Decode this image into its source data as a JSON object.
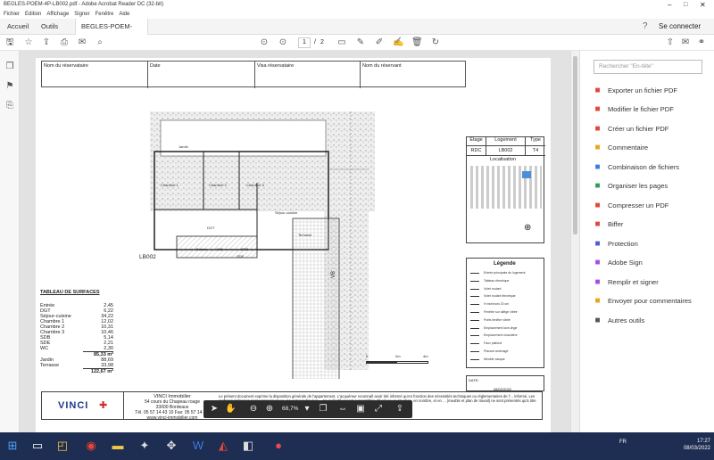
{
  "window": {
    "title": "BEGLES-POEM-4P-LB002.pdf - Adobe Acrobat Reader DC (32-bit)"
  },
  "menu": [
    "Fichier",
    "Edition",
    "Affichage",
    "Signer",
    "Fenêtre",
    "Aide"
  ],
  "tabs": {
    "home": "Accueil",
    "tools": "Outils",
    "doc": "BEGLES-POEM-4P-..."
  },
  "signin": "Se connecter",
  "pager": {
    "current": "1",
    "sep": "/",
    "total": "2"
  },
  "zoom": "68,7%",
  "panel": {
    "search_placeholder": "Rechercher \"En-tête\"",
    "items": [
      {
        "label": "Exporter un fichier PDF",
        "color": "#e3463b",
        "icon": "export-pdf-icon"
      },
      {
        "label": "Modifier le fichier PDF",
        "color": "#e3463b",
        "icon": "edit-pdf-icon"
      },
      {
        "label": "Créer un fichier PDF",
        "color": "#e3463b",
        "icon": "create-pdf-icon"
      },
      {
        "label": "Commentaire",
        "color": "#e7a51c",
        "icon": "comment-icon"
      },
      {
        "label": "Combinaison de fichiers",
        "color": "#3b7be8",
        "icon": "combine-icon"
      },
      {
        "label": "Organiser les pages",
        "color": "#2f9e5b",
        "icon": "organize-icon"
      },
      {
        "label": "Compresser un PDF",
        "color": "#e3463b",
        "icon": "compress-icon"
      },
      {
        "label": "Biffer",
        "color": "#e3463b",
        "icon": "redact-icon"
      },
      {
        "label": "Protection",
        "color": "#4c5cd4",
        "icon": "shield-icon"
      },
      {
        "label": "Adobe Sign",
        "color": "#a64de0",
        "icon": "sign-icon"
      },
      {
        "label": "Remplir et signer",
        "color": "#a64de0",
        "icon": "fill-sign-icon"
      },
      {
        "label": "Envoyer pour commentaires",
        "color": "#e7a51c",
        "icon": "send-comment-icon"
      },
      {
        "label": "Autres outils",
        "color": "#555555",
        "icon": "more-tools-icon"
      }
    ]
  },
  "doc": {
    "header": [
      "Nom du réservataire",
      "Date",
      "Visa réservataire",
      "Nom du réservant"
    ],
    "rooms": {
      "jardin": "Jardin",
      "ch1": "Chambre 1",
      "ch2": "Chambre 2",
      "ch3": "Chambre 3",
      "sejour": "Séjour-cuisine",
      "terrasse": "Terrasse",
      "dgt": "DGT",
      "entree": "Entrée",
      "wc": "WC",
      "sdb": "SDB",
      "sde": "SDE",
      "vb": "VB"
    },
    "lot_label": "LB002",
    "surfaces_title": "TABLEAU DE SURFACES",
    "surfaces": [
      {
        "name": "Entrée",
        "value": "2,45"
      },
      {
        "name": "DGT",
        "value": "6,22"
      },
      {
        "name": "Séjour-cuisine",
        "value": "34,22"
      },
      {
        "name": "Chambre 1",
        "value": "12,02"
      },
      {
        "name": "Chambre 2",
        "value": "10,31"
      },
      {
        "name": "Chambre 3",
        "value": "10,46"
      },
      {
        "name": "SDB",
        "value": "5,14"
      },
      {
        "name": "SDE",
        "value": "2,21"
      },
      {
        "name": "WC",
        "value": "2,30"
      }
    ],
    "total_habitable": "85,33 m²",
    "jardin_value": "88,69",
    "terrasse_value": "33,98",
    "total_all": "122,67 m²",
    "info_table": {
      "headers": [
        "Etage",
        "Logement",
        "Type"
      ],
      "values": [
        "RDC",
        "LB002",
        "T4"
      ],
      "localisation": "Localisation"
    },
    "legend_title": "Légende",
    "legend_items": [
      "Entrée principale du logement",
      "Tableau électrique",
      "Volet roulant",
      "Volet roulant électrique",
      "H minimum 20 cm",
      "Fenêtre sur allège vitrée",
      "Porte-fenêtre vitrée",
      "Emplacement lave-linge",
      "Emplacement chaudière",
      "Faux plafond",
      "Placard aménagé",
      "Meuble vasque"
    ],
    "date_label": "DATE:",
    "date": "08/02/2022",
    "company": {
      "name": "VINCI Immobilier",
      "l1": "54 cours du Chapeau rouge",
      "l2": "33000 Bordeaux",
      "l3": "Tél. 05 57 14 43 10 Fax: 05 57 14 4...",
      "l4": "www.vinci-immobilier.com"
    },
    "disclaimer": "Le présent document exprime la disposition générale de l'appartement. L'acquéreur reconnaît avoir été informé qu'en fonction des nécessités techniques ou réglementaires de l'... informé. Les surfaces indiquées sont approximatives, les cotes indiquées ... tre indicatif et sont susceptibles d'évoluer en situation, en nombre, et en ... (meuble et plan de travail) ne sont présentés qu'à titre indicatif. Le ...",
    "scale": [
      "0",
      "2m",
      "4m"
    ]
  },
  "taskbar": {
    "lang": "FR",
    "time": "17:27",
    "date": "08/03/2022"
  }
}
